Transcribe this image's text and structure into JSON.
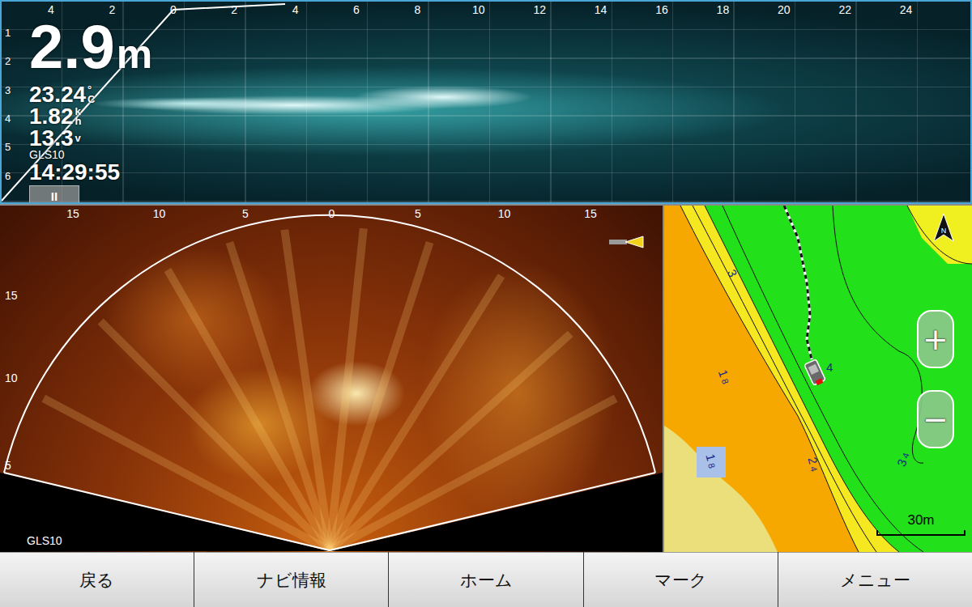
{
  "depth_panel": {
    "x_scale": [
      "4",
      "2",
      "0",
      "2",
      "4",
      "6",
      "8",
      "10",
      "12",
      "14",
      "16",
      "18",
      "20",
      "22",
      "24"
    ],
    "y_scale": [
      "1",
      "2",
      "3",
      "4",
      "5",
      "6"
    ],
    "depth": {
      "value": "2.9",
      "unit": "m"
    },
    "readings": [
      {
        "value": "23.24",
        "unit": [
          "°",
          "C"
        ]
      },
      {
        "value": "1.82",
        "unit": [
          "k",
          "h"
        ]
      },
      {
        "value": "13.3",
        "unit": [
          "v"
        ]
      }
    ],
    "source": "GLS10",
    "time": "14:29:55",
    "pause_button": "II"
  },
  "fan_panel": {
    "x_scale": [
      "15",
      "10",
      "5",
      "0",
      "5",
      "10",
      "15"
    ],
    "y_scale": [
      "15",
      "10",
      "5"
    ],
    "source": "GLS10"
  },
  "map": {
    "contour_labels": [
      {
        "whole": "3"
      },
      {
        "whole": "1",
        "tenth": "8"
      },
      {
        "whole": "1",
        "tenth": "8"
      },
      {
        "whole": "2",
        "tenth": "4"
      },
      {
        "whole": "3",
        "tenth": "4"
      },
      {
        "whole": "4"
      }
    ],
    "north": "N",
    "zoom_in": "+",
    "zoom_out": "−",
    "scale": "30m"
  },
  "buttons": [
    {
      "label": "戻る"
    },
    {
      "label": "ナビ情報"
    },
    {
      "label": "ホーム"
    },
    {
      "label": "マーク"
    },
    {
      "label": "メニュー"
    }
  ]
}
